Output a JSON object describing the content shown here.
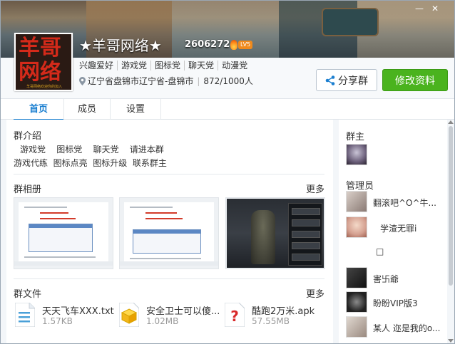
{
  "window": {
    "minimize_label": "—",
    "close_label": "✕"
  },
  "group": {
    "name": "★羊哥网络★",
    "id": "2606272",
    "level": "LV5",
    "avatar_text": [
      "羊哥",
      "网络",
      "羊哥网络欢迎你的加入"
    ],
    "tags": [
      "兴趣爱好",
      "游戏党",
      "图标党",
      "聊天党",
      "动漫党"
    ],
    "location": "辽宁省盘锦市辽宁省-盘锦市",
    "member_count": "872/1000人"
  },
  "buttons": {
    "share": "分享群",
    "edit": "修改资料"
  },
  "tabs": [
    {
      "label": "首页",
      "active": true
    },
    {
      "label": "成员",
      "active": false
    },
    {
      "label": "设置",
      "active": false
    }
  ],
  "intro": {
    "title": "群介绍",
    "lines": [
      "游戏党    图标党    聊天党    请进本群",
      "游戏代练  图标点亮  图标升级  联系群主"
    ]
  },
  "album": {
    "title": "群相册",
    "more": "更多"
  },
  "files": {
    "title": "群文件",
    "more": "更多",
    "items": [
      {
        "name": "天天飞车XXX.txt",
        "size": "1.57KB",
        "icon": "txt-file-icon"
      },
      {
        "name": "安全卫士可以傻...",
        "size": "1.02MB",
        "icon": "package-file-icon"
      },
      {
        "name": "酷跑2万米.apk",
        "size": "57.55MB",
        "icon": "apk-file-icon"
      }
    ]
  },
  "owner": {
    "title": "群主"
  },
  "admins": {
    "title": "管理员",
    "members": [
      {
        "name": "翻滚吧^O^牛..."
      },
      {
        "name": "学渣无罪i"
      },
      {
        "name": "□"
      },
      {
        "name": "害卐爺"
      },
      {
        "name": "盼盼VIP版3"
      },
      {
        "name": "某人 迩是我的o..."
      }
    ]
  },
  "colors": {
    "accent": "#1b7fd0",
    "primary_button": "#4ab31e"
  }
}
